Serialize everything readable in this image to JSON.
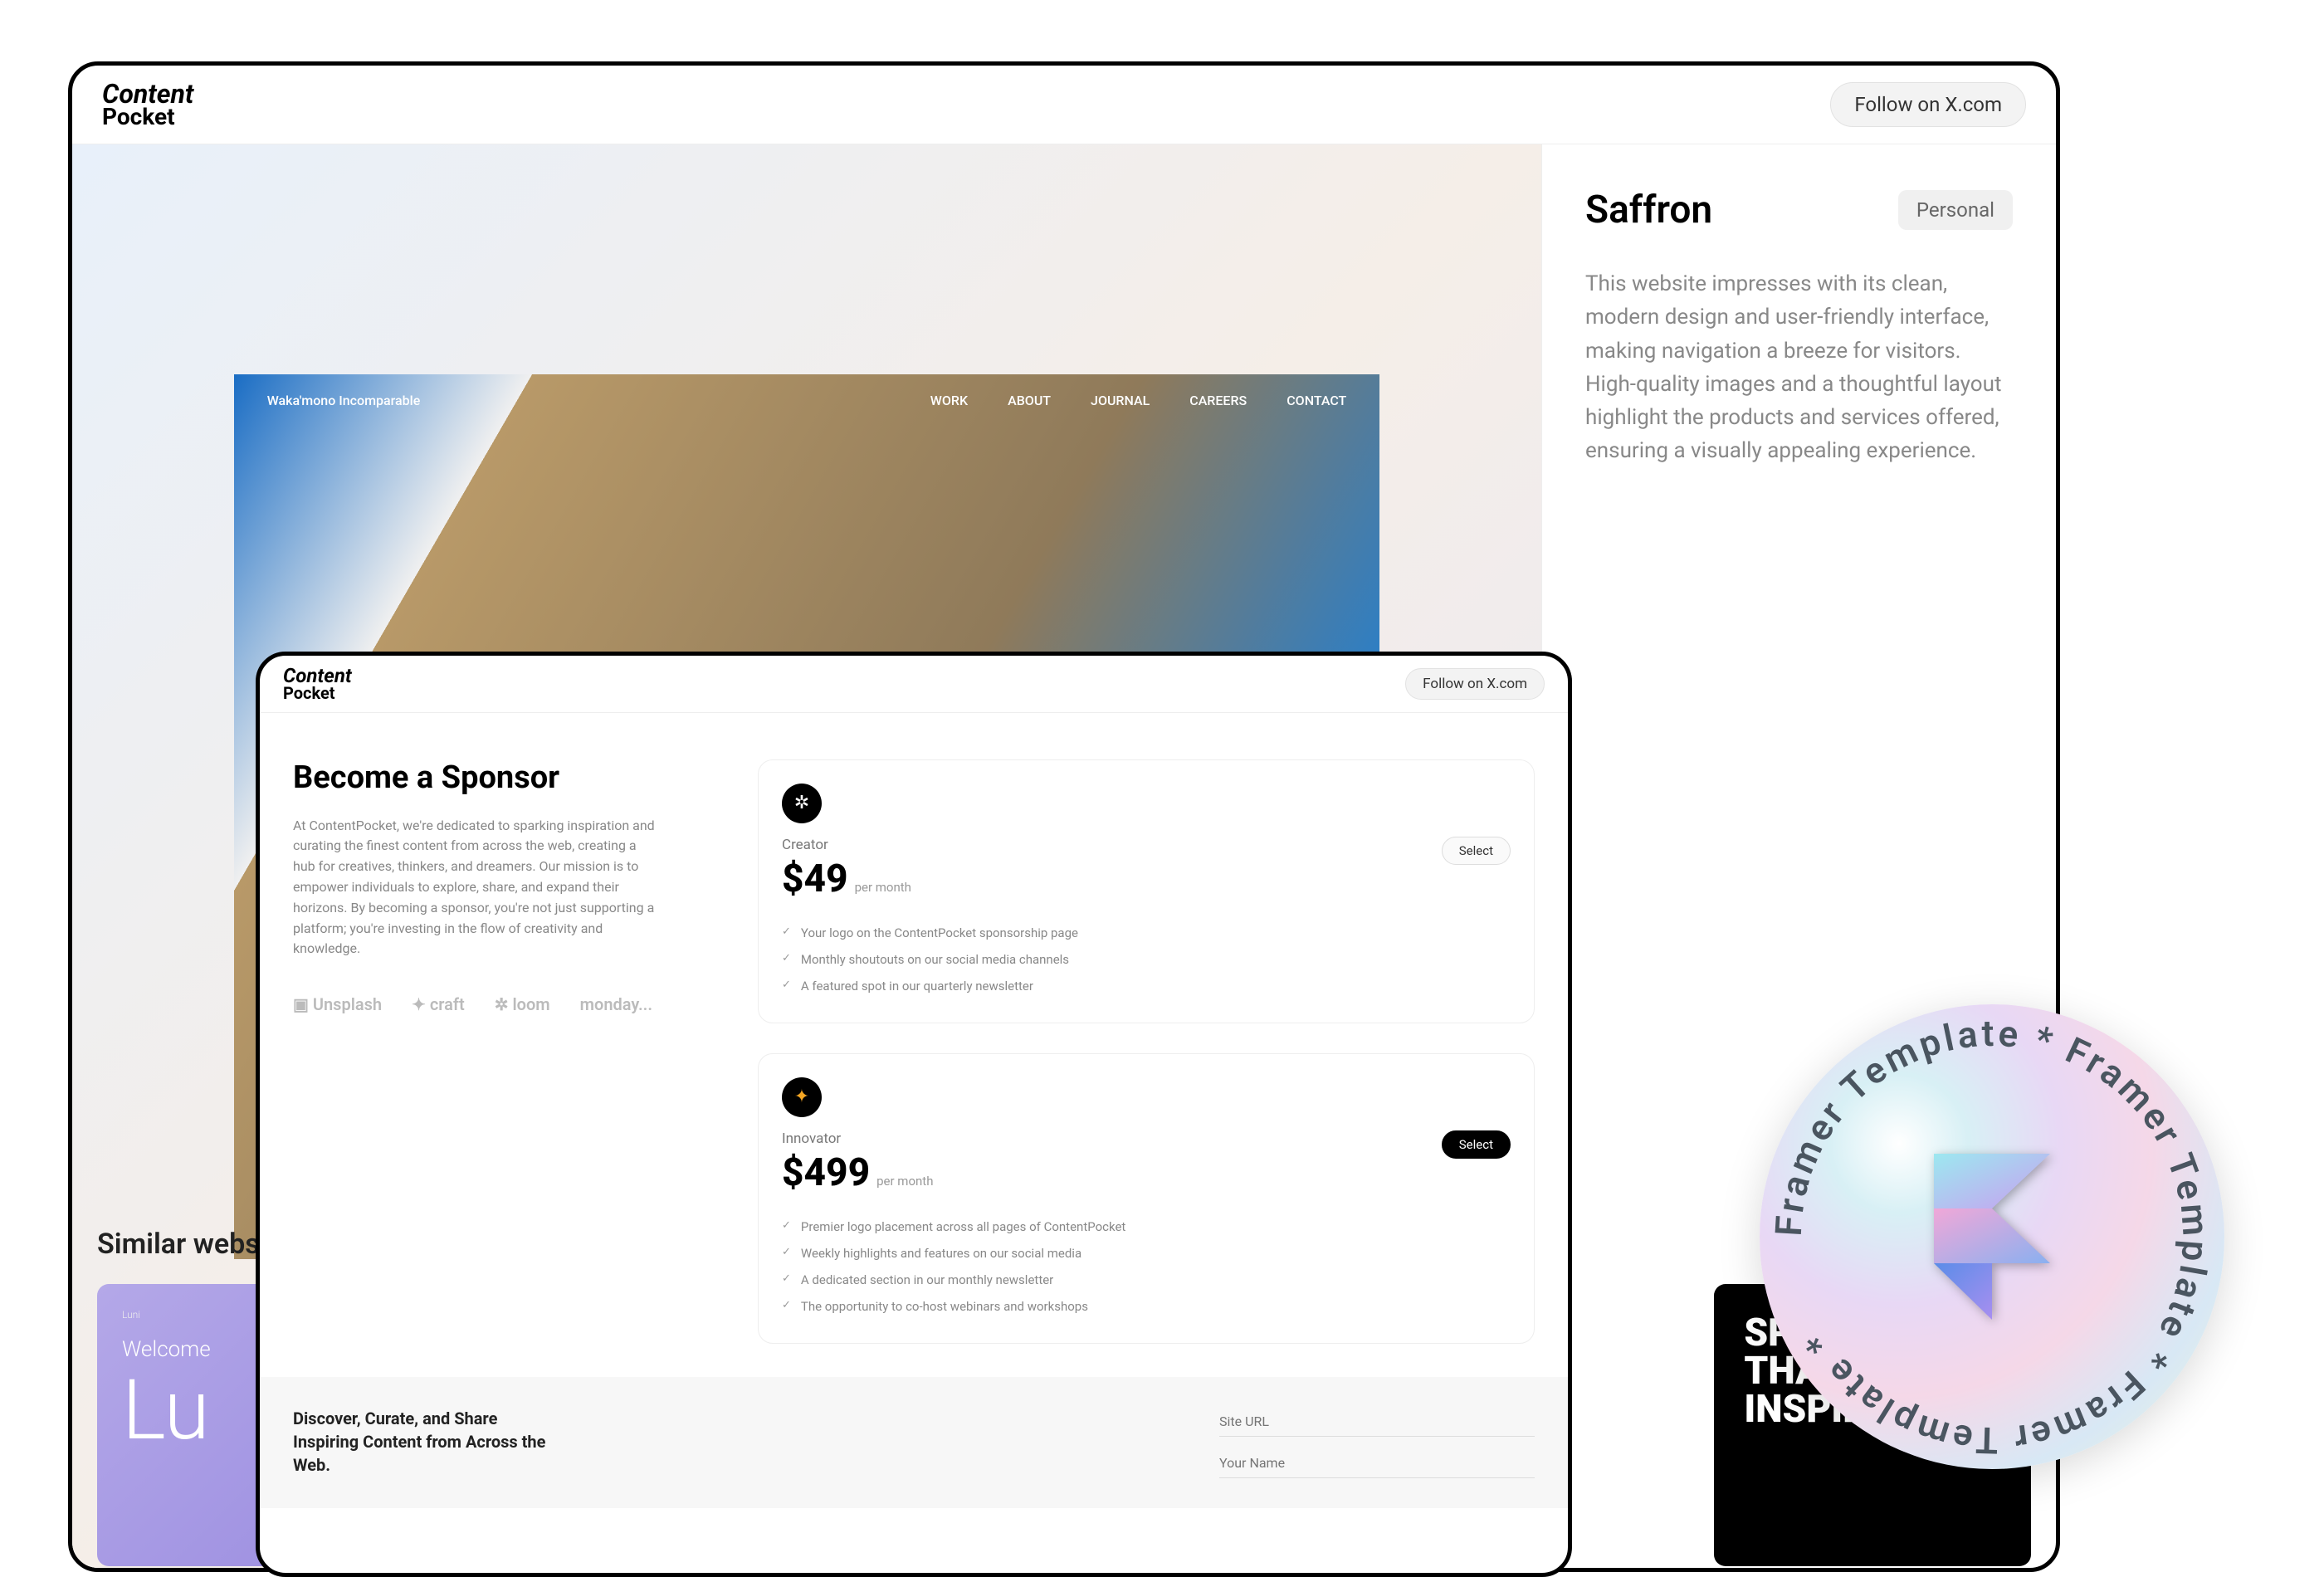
{
  "brand": {
    "line1": "Content",
    "line2": "Pocket"
  },
  "follow_label": "Follow on X.com",
  "back": {
    "mock_nav": {
      "brand": "Waka'mono Incomparable",
      "items": [
        "WORK",
        "ABOUT",
        "JOURNAL",
        "CAREERS",
        "CONTACT"
      ]
    },
    "title": "Saffron",
    "badge": "Personal",
    "description": "This website impresses with its clean, modern design and user-friendly interface, making navigation a breeze for visitors. High-quality images and a thoughtful layout highlight the products and services offered, ensuring a visually appealing experience.",
    "similar_title": "Similar websites",
    "similar": [
      {
        "label": "Welcome",
        "big": "Lu"
      },
      {
        "line1": "SPACES",
        "line2": "THAT",
        "line3": "INSPIRE"
      }
    ]
  },
  "front": {
    "title": "Become a Sponsor",
    "description": "At ContentPocket, we're dedicated to sparking inspiration and curating the finest content from across the web, creating a hub for creatives, thinkers, and dreamers. Our mission is to empower individuals to explore, share, and expand their horizons. By becoming a sponsor, you're not just supporting a platform; you're investing in the flow of creativity and knowledge.",
    "logos": [
      "Unsplash",
      "craft",
      "loom",
      "monday..."
    ],
    "plans": [
      {
        "name": "Creator",
        "price": "$49",
        "per": "per month",
        "select": "Select",
        "features": [
          "Your logo on the ContentPocket sponsorship page",
          "Monthly shoutouts on our social media channels",
          "A featured spot in our quarterly newsletter"
        ]
      },
      {
        "name": "Innovator",
        "price": "$499",
        "per": "per month",
        "select": "Select",
        "features": [
          "Premier logo placement across all pages of ContentPocket",
          "Weekly highlights and features on our social media",
          "A dedicated section in our monthly newsletter",
          "The opportunity to co-host webinars and workshops"
        ]
      }
    ],
    "footer": {
      "title": "Discover, Curate, and Share Inspiring Content from Across the Web.",
      "inputs": [
        "Site URL",
        "Your Name"
      ]
    }
  },
  "sticker": {
    "text": "Framer Template  *  Framer Template  *  Framer Template  *  "
  }
}
